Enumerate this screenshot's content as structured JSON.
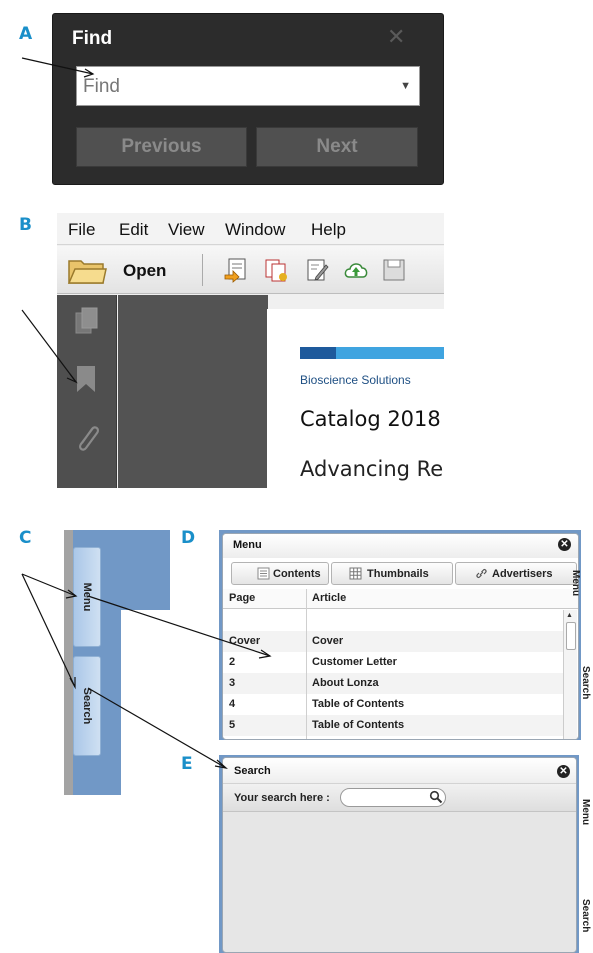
{
  "labels": {
    "a": "A",
    "b": "B",
    "c": "C",
    "d": "D",
    "e": "E"
  },
  "find_panel": {
    "title": "Find",
    "input_placeholder": "Find",
    "previous_label": "Previous",
    "next_label": "Next"
  },
  "acrobat": {
    "menu": [
      "File",
      "Edit",
      "View",
      "Window",
      "Help"
    ],
    "open_label": "Open",
    "page": {
      "company": "Bioscience Solutions",
      "title": "Catalog 2018",
      "subtitle": "Advancing Re"
    }
  },
  "side_tabs": {
    "menu": "Menu",
    "search": "Search"
  },
  "menu_panel": {
    "title": "Menu",
    "tabs": [
      "Contents",
      "Thumbnails",
      "Advertisers"
    ],
    "columns": [
      "Page",
      "Article"
    ],
    "rows": [
      {
        "page": "",
        "article": ""
      },
      {
        "page": "Cover",
        "article": "Cover"
      },
      {
        "page": "2",
        "article": "Customer Letter"
      },
      {
        "page": "3",
        "article": "About Lonza"
      },
      {
        "page": "4",
        "article": "Table of Contents"
      },
      {
        "page": "5",
        "article": "Table of Contents"
      }
    ],
    "side_tabs": [
      "Menu",
      "Search"
    ]
  },
  "search_panel": {
    "title": "Search",
    "label": "Your search here :",
    "side_tabs": [
      "Menu",
      "Search"
    ]
  },
  "colors": {
    "label_blue": "#1a8fc9",
    "viewer_blue": "#7198c6",
    "acrobat_dark": "#4f4f4f"
  }
}
